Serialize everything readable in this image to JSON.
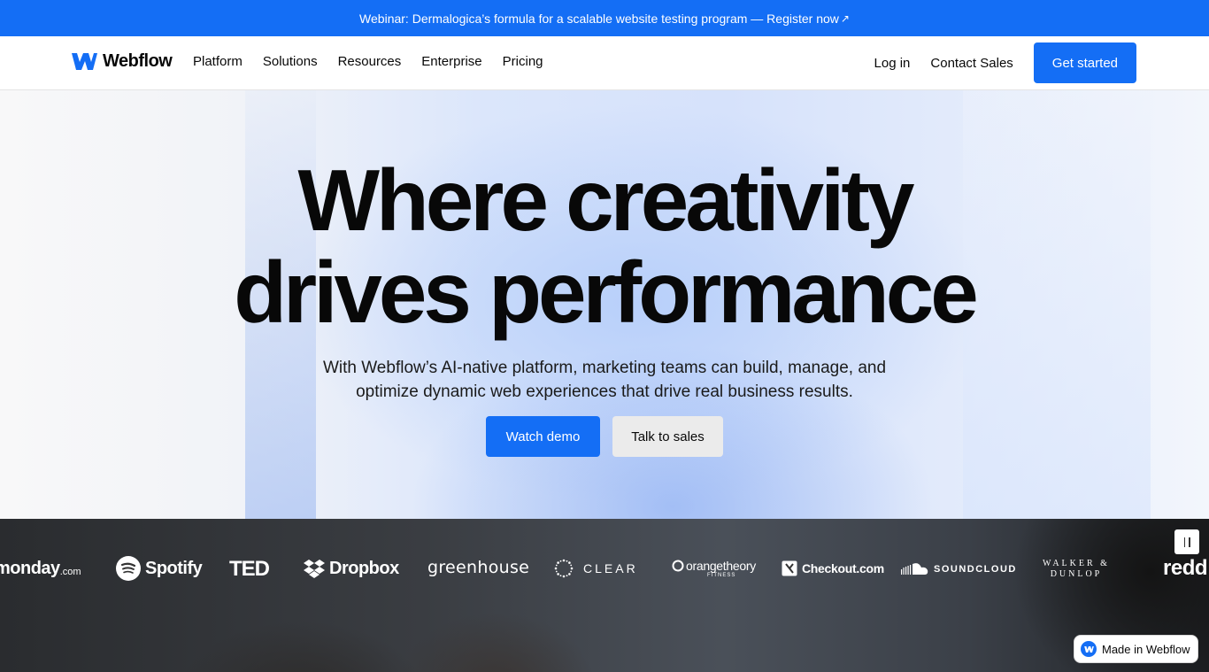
{
  "banner": {
    "text": "Webinar: Dermalogica’s formula for a scalable website testing program — Register now",
    "arrow": "↗"
  },
  "nav": {
    "logo_text": "Webflow",
    "links": [
      "Platform",
      "Solutions",
      "Resources",
      "Enterprise",
      "Pricing"
    ],
    "login": "Log in",
    "contact": "Contact Sales",
    "cta": "Get started"
  },
  "hero": {
    "headline_line1": "Where creativity",
    "headline_line2": "drives performance",
    "sub_line1": "With Webflow’s AI-native platform, marketing teams can build, manage, and",
    "sub_line2": "optimize dynamic web experiences that drive real business results.",
    "primary_button": "Watch demo",
    "secondary_button": "Talk to sales"
  },
  "logos": {
    "items": [
      "monday.com",
      "Spotify",
      "TED",
      "Dropbox",
      "greenhouse",
      "CLEAR",
      "orangetheory",
      "Checkout.com",
      "SOUNDCLOUD",
      "WALKER & DUNLOP",
      "reddit"
    ],
    "monday_main": "monday",
    "monday_suffix": ".com",
    "orange_sub": "FITNESS",
    "walker_line1": "WALKER &",
    "walker_line2": "DUNLOP",
    "reddit_visible": "redd"
  },
  "badge": {
    "text": "Made in Webflow"
  },
  "colors": {
    "brand_blue": "#146ef5",
    "text_dark": "#080808"
  }
}
